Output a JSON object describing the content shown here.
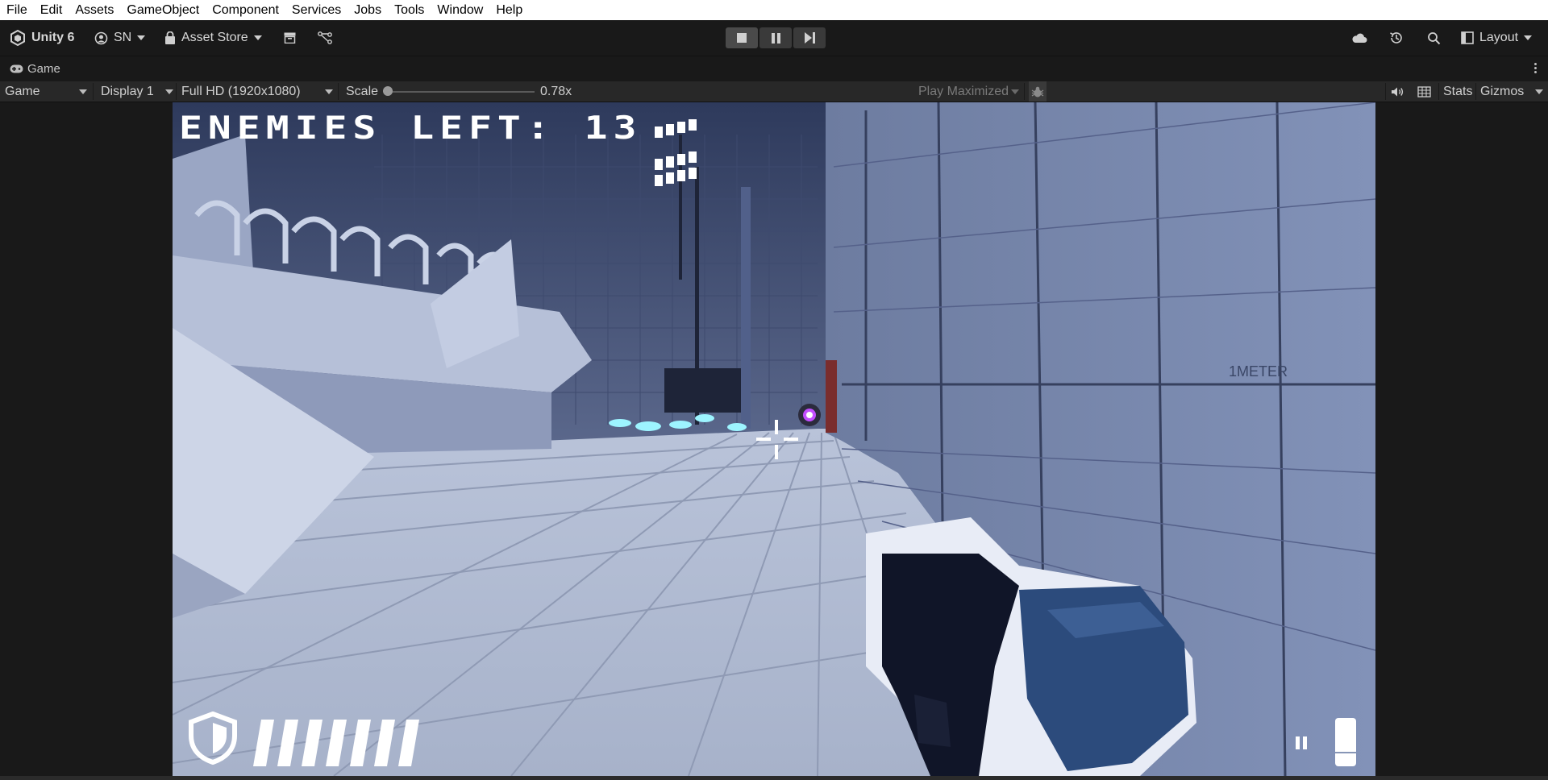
{
  "menu": [
    "File",
    "Edit",
    "Assets",
    "GameObject",
    "Component",
    "Services",
    "Jobs",
    "Tools",
    "Window",
    "Help"
  ],
  "toolbar": {
    "product": "Unity 6",
    "account": "SN",
    "asset_store": "Asset Store",
    "layout": "Layout"
  },
  "tab": {
    "label": "Game"
  },
  "game_controls": {
    "mode": "Game",
    "display": "Display 1",
    "resolution": "Full HD (1920x1080)",
    "scale_label": "Scale",
    "scale_value": "0.78x",
    "scale_fraction": 0.0,
    "play_maximized": "Play Maximized",
    "stats": "Stats",
    "gizmos": "Gizmos"
  },
  "hud": {
    "enemies_text": "ENEMIES LEFT: 13",
    "armor_bars": 7
  },
  "colors": {
    "editor_bg": "#191919",
    "toolbar_bg": "#282828",
    "scene_tint": "#8796b6",
    "enemy_glow": "#c24dff",
    "hud_white": "#ffffff"
  },
  "icons": [
    "unity-logo-icon",
    "account-icon",
    "asset-store-icon",
    "package-icon",
    "version-control-icon",
    "stop-icon",
    "pause-icon",
    "step-icon",
    "cloud-icon",
    "history-icon",
    "search-icon",
    "layout-icon",
    "gamepad-icon",
    "bug-icon",
    "audio-icon",
    "grid-icon",
    "shield-icon",
    "ammo-icon"
  ]
}
